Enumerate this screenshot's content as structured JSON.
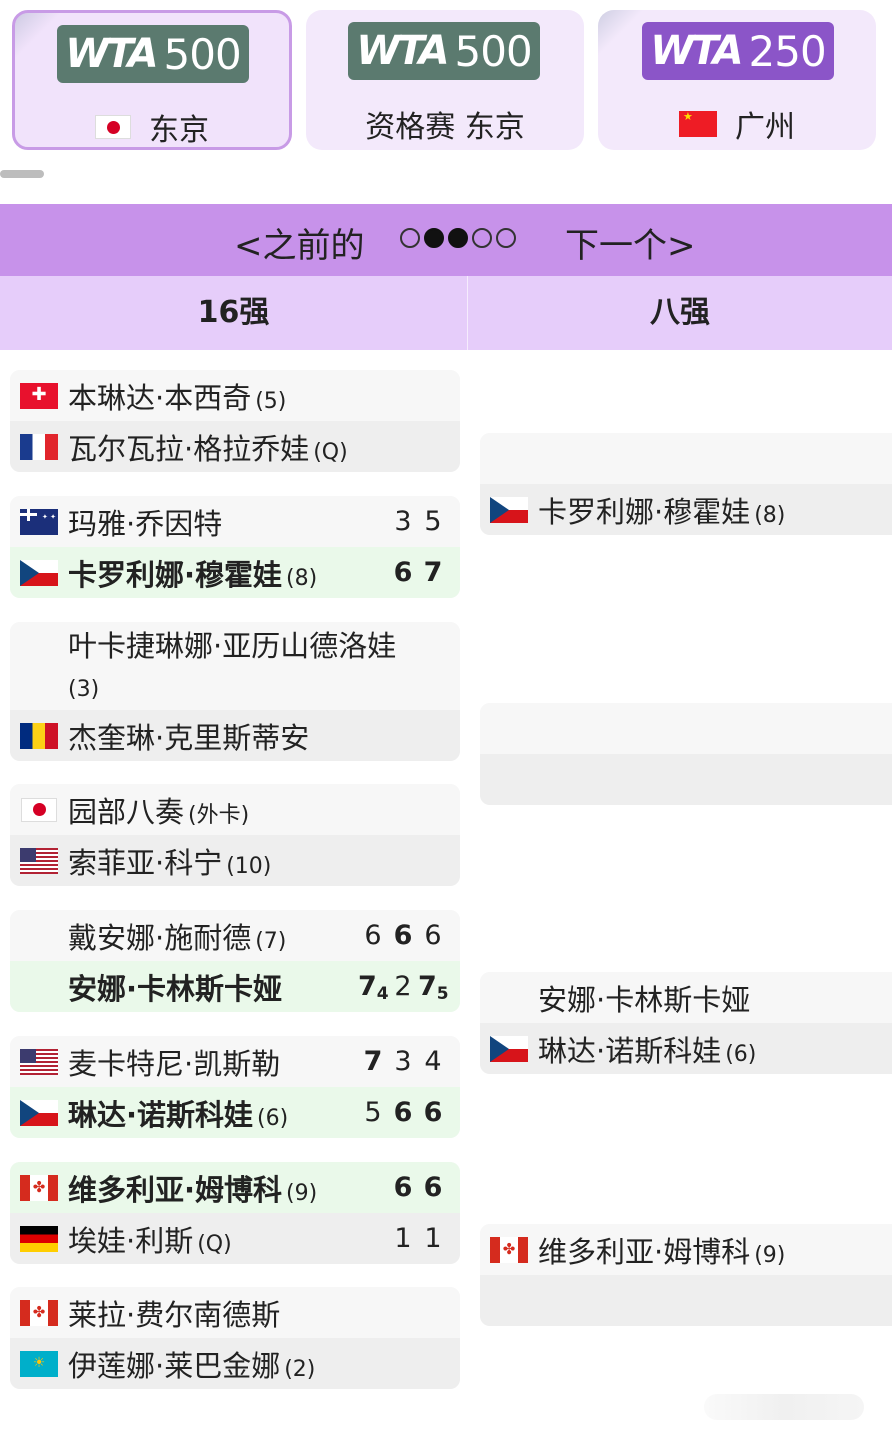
{
  "tournaments": [
    {
      "logo_brand": "WTA",
      "logo_level": "500",
      "logo_color": "#5b7a6f",
      "flag": "flag-jp",
      "label": "东京",
      "selected": true
    },
    {
      "logo_brand": "WTA",
      "logo_level": "500",
      "logo_color": "#5b7a6f",
      "flag": "",
      "label": "资格赛 东京",
      "selected": false
    },
    {
      "logo_brand": "WTA",
      "logo_level": "250",
      "logo_color": "#8b55c8",
      "flag": "flag-cn",
      "label": "广州",
      "selected": false
    }
  ],
  "nav": {
    "prev_label": "<之前的",
    "next_label": "下一个>",
    "dots": [
      false,
      true,
      true,
      false,
      false
    ]
  },
  "rounds": {
    "left": "16强",
    "right": "八强"
  },
  "r16": [
    {
      "p1": {
        "flag": "flag-ch",
        "name": "本琳达·本西奇",
        "seed": "(5)",
        "scores": [],
        "winner": false
      },
      "p2": {
        "flag": "flag-fr",
        "name": "瓦尔瓦拉·格拉乔娃",
        "seed": "(Q)",
        "scores": [],
        "winner": false
      }
    },
    {
      "p1": {
        "flag": "flag-au",
        "name": "玛雅·乔因特",
        "seed": "",
        "scores": [
          "3",
          "5"
        ],
        "winner": false
      },
      "p2": {
        "flag": "flag-cz",
        "name": "卡罗利娜·穆霍娃",
        "seed": "(8)",
        "scores": [
          "6",
          "7"
        ],
        "winner": true
      }
    },
    {
      "p1": {
        "flag": "",
        "name": "叶卡捷琳娜·亚历山德洛娃",
        "seed": "(3)",
        "scores": [],
        "winner": false
      },
      "p2": {
        "flag": "flag-ro",
        "name": "杰奎琳·克里斯蒂安",
        "seed": "",
        "scores": [],
        "winner": false
      }
    },
    {
      "p1": {
        "flag": "flag-jp",
        "name": "园部八奏",
        "seed": "(外卡)",
        "scores": [],
        "winner": false
      },
      "p2": {
        "flag": "flag-us",
        "name": "索菲亚·科宁",
        "seed": "(10)",
        "scores": [],
        "winner": false
      }
    },
    {
      "p1": {
        "flag": "",
        "name": "戴安娜·施耐德",
        "seed": "(7)",
        "scores": [
          "6",
          "6",
          "6"
        ],
        "winner": false
      },
      "p2": {
        "flag": "",
        "name": "安娜·卡林斯卡娅",
        "seed": "",
        "scores": [
          "7",
          "2",
          "7"
        ],
        "tiebreaks": [
          "4",
          "",
          "5"
        ],
        "winner": true
      }
    },
    {
      "p1": {
        "flag": "flag-us",
        "name": "麦卡特尼·凯斯勒",
        "seed": "",
        "scores": [
          "7",
          "3",
          "4"
        ],
        "winner": false
      },
      "p2": {
        "flag": "flag-cz",
        "name": "琳达·诺斯科娃",
        "seed": "(6)",
        "scores": [
          "5",
          "6",
          "6"
        ],
        "winner": true
      }
    },
    {
      "p1": {
        "flag": "flag-ca",
        "name": "维多利亚·姆博科",
        "seed": "(9)",
        "scores": [
          "6",
          "6"
        ],
        "winner": true
      },
      "p2": {
        "flag": "flag-de",
        "name": "埃娃·利斯",
        "seed": "(Q)",
        "scores": [
          "1",
          "1"
        ],
        "winner": false
      }
    },
    {
      "p1": {
        "flag": "flag-ca",
        "name": "莱拉·费尔南德斯",
        "seed": "",
        "scores": [],
        "winner": false
      },
      "p2": {
        "flag": "flag-kz",
        "name": "伊莲娜·莱巴金娜",
        "seed": "(2)",
        "scores": [],
        "winner": false
      }
    }
  ],
  "qf": [
    {
      "p1": {
        "flag": "",
        "name": "",
        "seed": ""
      },
      "p2": {
        "flag": "flag-cz",
        "name": "卡罗利娜·穆霍娃",
        "seed": "(8)"
      }
    },
    {
      "p1": {
        "flag": "",
        "name": "",
        "seed": ""
      },
      "p2": {
        "flag": "",
        "name": "",
        "seed": ""
      }
    },
    {
      "p1": {
        "flag": "",
        "name": "安娜·卡林斯卡娅",
        "seed": ""
      },
      "p2": {
        "flag": "flag-cz",
        "name": "琳达·诺斯科娃",
        "seed": "(6)"
      }
    },
    {
      "p1": {
        "flag": "flag-ca",
        "name": "维多利亚·姆博科",
        "seed": "(9)"
      },
      "p2": {
        "flag": "",
        "name": "",
        "seed": ""
      }
    }
  ]
}
